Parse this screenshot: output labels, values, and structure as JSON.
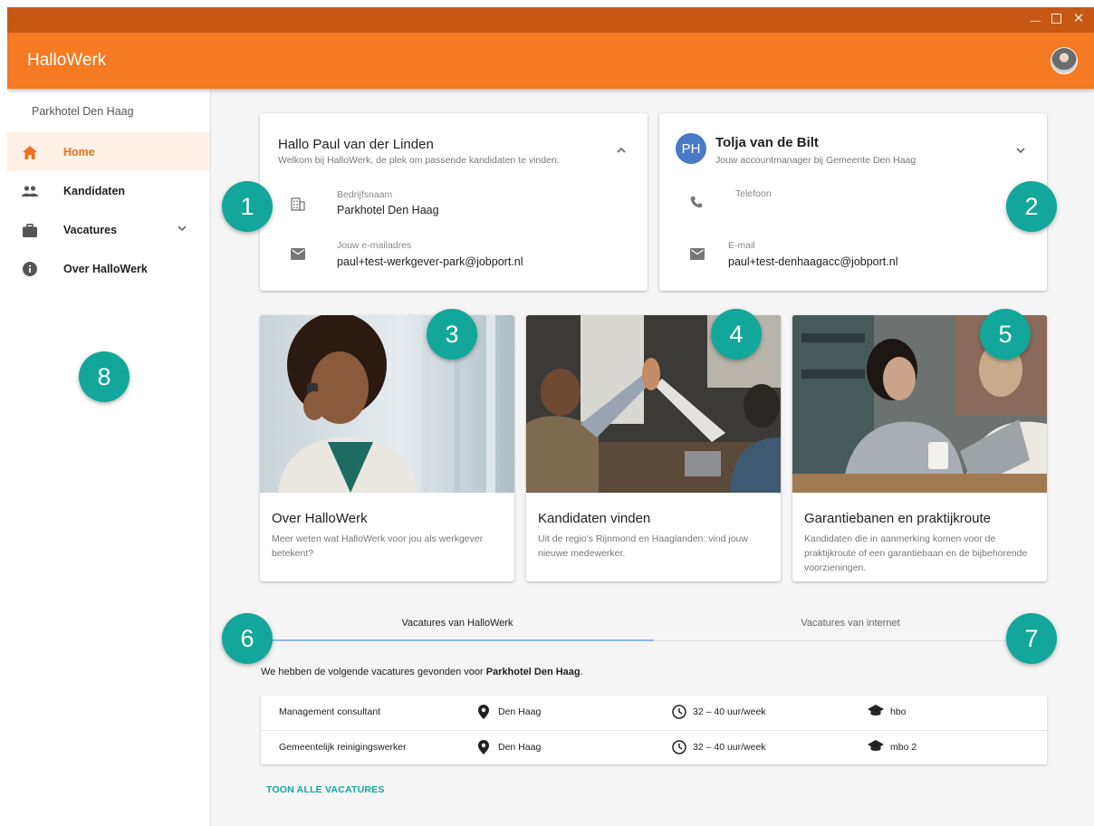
{
  "window": {
    "minimize": "_",
    "close": "✕"
  },
  "app": {
    "title": "HalloWerk"
  },
  "sidebar": {
    "org": "Parkhotel Den Haag",
    "items": [
      {
        "label": "Home",
        "icon": "home-icon",
        "active": true
      },
      {
        "label": "Kandidaten",
        "icon": "people-icon"
      },
      {
        "label": "Vacatures",
        "icon": "briefcase-icon",
        "expandable": true
      },
      {
        "label": "Over HalloWerk",
        "icon": "info-icon"
      }
    ]
  },
  "welcome_card": {
    "title": "Hallo Paul van der Linden",
    "subtitle": "Welkom bij HalloWerk, de plek om passende kandidaten te vinden.",
    "company_label": "Bedrijfsnaam",
    "company_value": "Parkhotel Den Haag",
    "email_label": "Jouw e-mailadres",
    "email_value": "paul+test-werkgever-park@jobport.nl"
  },
  "manager_card": {
    "initials": "PH",
    "name": "Tolja van de Bilt",
    "subtitle": "Jouw accountmanager bij Gemeente Den Haag",
    "phone_label": "Telefoon",
    "email_label": "E-mail",
    "email_value": "paul+test-denhaagacc@jobport.nl"
  },
  "image_cards": [
    {
      "title": "Over HalloWerk",
      "text": "Meer weten wat HalloWerk voor jou als werkgever betekent?"
    },
    {
      "title": "Kandidaten vinden",
      "text": "Uit de regio's Rijnmond en Haaglanden: vind jouw nieuwe medewerker."
    },
    {
      "title": "Garantiebanen en praktijkroute",
      "text": "Kandidaten die in aanmerking komen voor de praktijkroute of een garantiebaan en de bijbehorende voorzieningen."
    }
  ],
  "badges": [
    "1",
    "2",
    "3",
    "4",
    "5",
    "6",
    "7",
    "8"
  ],
  "tabs": [
    {
      "label": "Vacatures van HalloWerk",
      "active": true
    },
    {
      "label": "Vacatures van internet"
    }
  ],
  "found": {
    "prefix": "We hebben de volgende vacatures gevonden voor ",
    "company": "Parkhotel Den Haag",
    "suffix": "."
  },
  "vacancies": [
    {
      "title": "Management consultant",
      "location": "Den Haag",
      "hours": "32 – 40 uur/week",
      "level": "hbo"
    },
    {
      "title": "Gemeentelijk reinigingswerker",
      "location": "Den Haag",
      "hours": "32 – 40 uur/week",
      "level": "mbo 2"
    }
  ],
  "show_all": "TOON ALLE VACATURES",
  "colors": {
    "brand": "#f57a22",
    "titlebar": "#c65813",
    "badge": "#12a79a",
    "active_nav_bg": "#fdf0e6"
  }
}
